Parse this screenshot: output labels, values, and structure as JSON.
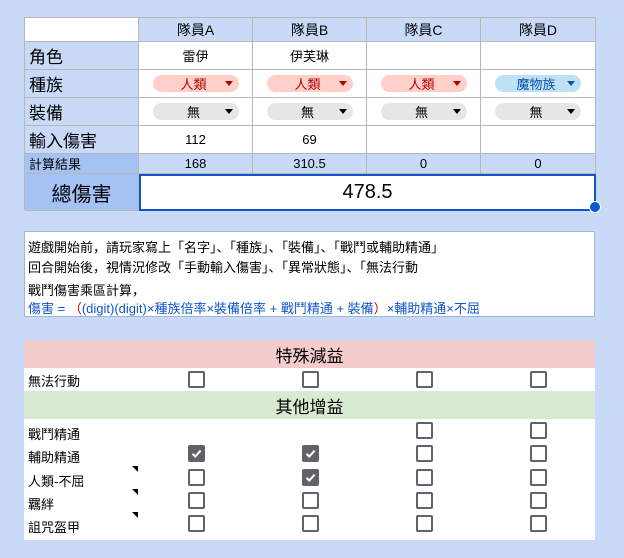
{
  "table": {
    "headers": [
      "隊員A",
      "隊員B",
      "隊員C",
      "隊員D"
    ],
    "rows": {
      "role": {
        "label": "角色",
        "values": [
          "雷伊",
          "伊芙琳",
          "",
          ""
        ]
      },
      "race": {
        "label": "種族",
        "values": [
          "人類",
          "人類",
          "人類",
          "魔物族"
        ]
      },
      "equip": {
        "label": "裝備",
        "values": [
          "無",
          "無",
          "無",
          "無"
        ]
      },
      "input": {
        "label": "輸入傷害",
        "values": [
          "112",
          "69",
          "",
          ""
        ]
      },
      "result": {
        "label": "計算結果",
        "values": [
          "168",
          "310.5",
          "0",
          "0"
        ]
      }
    },
    "total": {
      "label": "總傷害",
      "value": "478.5"
    }
  },
  "notes": {
    "line1": "遊戲開始前，請玩家寫上「名字」、「種族」、「裝備」、「戰鬥或輔助精通」",
    "line2": "回合開始後，視情況修改「手動輸入傷害」、「異常狀態」、「無法行動",
    "line3": "戰鬥傷害乘區計算，",
    "formula": {
      "prefix": "傷害 = ",
      "open": "（",
      "body": "(digit)(digit)×種族倍率×裝備倍率 + 戰鬥精通 + 裝備",
      "close": "）",
      "suffix": "×輔助精通×不屈"
    }
  },
  "debuff": {
    "title": "特殊減益",
    "rows": [
      {
        "label": "無法行動",
        "checks": [
          false,
          false,
          false,
          false
        ]
      }
    ]
  },
  "buff": {
    "title": "其他增益",
    "rows": [
      {
        "label": "戰鬥精通",
        "checks": [
          null,
          null,
          false,
          false
        ]
      },
      {
        "label": "輔助精通",
        "checks": [
          true,
          true,
          false,
          false
        ]
      },
      {
        "label": "人類-不屈",
        "checks": [
          false,
          true,
          false,
          false
        ]
      },
      {
        "label": "羈絆",
        "checks": [
          false,
          false,
          false,
          false
        ]
      },
      {
        "label": "詛咒盔甲",
        "checks": [
          false,
          false,
          false,
          false
        ]
      }
    ]
  },
  "colors": {
    "background": "#c9daf8",
    "debuff_header": "#f4cccc",
    "buff_header": "#d9ead3",
    "selection": "#1155cc",
    "formula_blue": "#1155cc",
    "formula_red": "#cc0000"
  }
}
